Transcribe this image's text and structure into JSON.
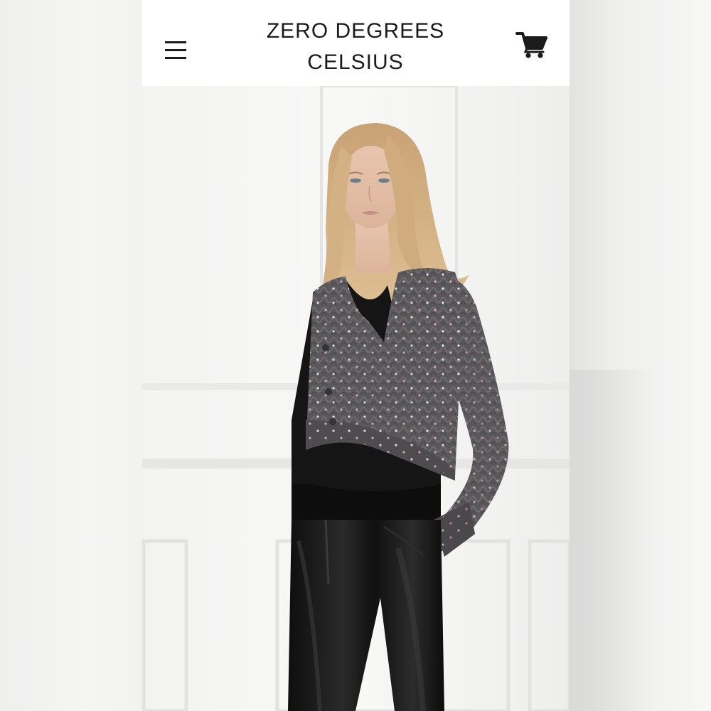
{
  "header": {
    "brand_line1": "ZERO DEGREES",
    "brand_line2": "CELSIUS",
    "menu_icon": "hamburger-menu-icon",
    "cart_icon": "shopping-cart-icon"
  },
  "hero": {
    "image": "model-wearing-cropped-cable-knit-cardigan-photo"
  },
  "colors": {
    "header_bg": "#ffffff",
    "brand_text": "#1b1b1b",
    "page_bg": "#f4f4f3"
  }
}
